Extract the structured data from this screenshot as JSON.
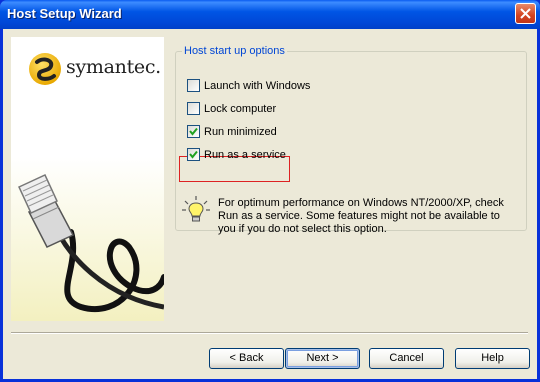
{
  "window": {
    "title": "Host Setup Wizard"
  },
  "brand": {
    "logo_text": "symantec."
  },
  "options_group": {
    "legend": "Host start up options",
    "options": [
      {
        "label": "Launch with Windows",
        "checked": false
      },
      {
        "label": "Lock computer",
        "checked": false
      },
      {
        "label": "Run minimized",
        "checked": true
      },
      {
        "label": "Run as a service",
        "checked": true
      }
    ],
    "info": "For optimum performance on Windows NT/2000/XP, check Run as a service. Some features might not be available to you if you do not select this option."
  },
  "buttons": {
    "back": "< Back",
    "next": "Next >",
    "cancel": "Cancel",
    "help": "Help"
  },
  "colors": {
    "title_bar": "#0055e5",
    "dialog_bg": "#ece9d8",
    "legend_text": "#0046d5",
    "highlight_border": "#dd2222"
  },
  "icons": {
    "close": "close-icon",
    "info": "lightbulb-icon",
    "checkbox_checked": "check-icon"
  }
}
